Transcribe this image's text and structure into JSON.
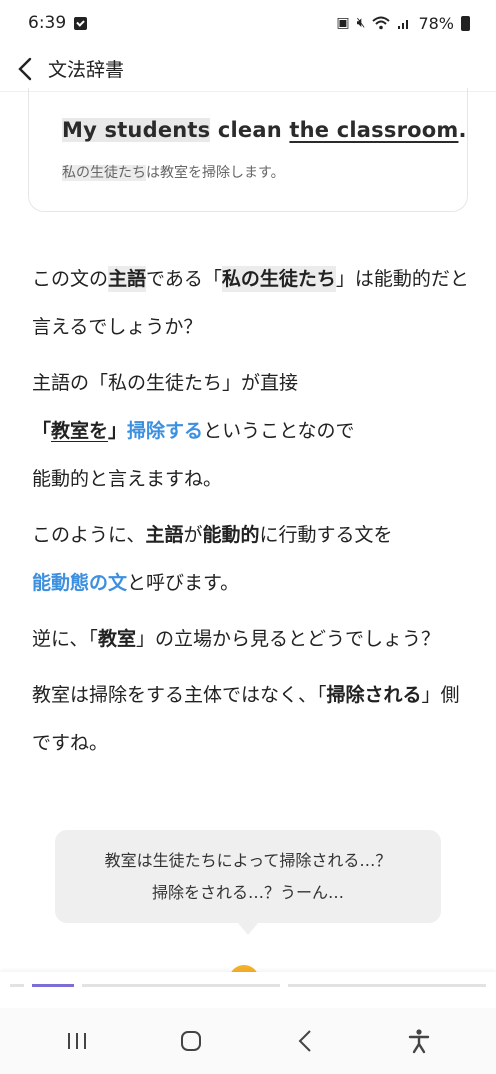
{
  "status": {
    "time": "6:39",
    "battery": "78%"
  },
  "header": {
    "title": "文法辞書"
  },
  "example": {
    "en_subject": "My students",
    "en_verb": " clean ",
    "en_object": "the classroom",
    "en_end": ".",
    "ja_subject": "私の生徒たち",
    "ja_rest": "は教室を掃除します。"
  },
  "article": {
    "p1": {
      "a": "この文の",
      "b": "主語",
      "c": "である「",
      "d": "私の生徒たち",
      "e": "」は能動的だと言えるでしょうか？"
    },
    "p2": {
      "a": "主語の「私の生徒たち」が直接",
      "b": "「",
      "c": "教室を",
      "d": "」",
      "e": "掃除する",
      "f": "ということなので",
      "g": "能動的と言えますね。"
    },
    "p3": {
      "a": "このように、",
      "b": "主語",
      "c": "が",
      "d": "能動的",
      "e": "に行動する文を",
      "f": "能動態の文",
      "g": "と呼びます。"
    },
    "p4": {
      "a": "逆に、「",
      "b": "教室",
      "c": "」の立場から見るとどうでしょう？"
    },
    "p5": {
      "a": "教室は掃除をする主体ではなく、「",
      "b": "掃除される",
      "c": "」側ですね。"
    }
  },
  "bubble": {
    "line1": "教室は生徒たちによって掃除される…？",
    "line2": "掃除をされる…？うーん…"
  },
  "icons": {
    "notification": "notification-icon",
    "mute": "mute-icon",
    "wifi": "wifi-icon",
    "signal": "signal-icon",
    "battery": "battery-icon",
    "back": "chevron-left-icon",
    "recents": "recents-icon",
    "home": "home-icon",
    "nav_back": "nav-back-icon",
    "accessibility": "accessibility-icon"
  },
  "colors": {
    "accent_blue": "#3d8fe0",
    "progress": "#7b6fd6",
    "emoji": "#f5b12a"
  }
}
